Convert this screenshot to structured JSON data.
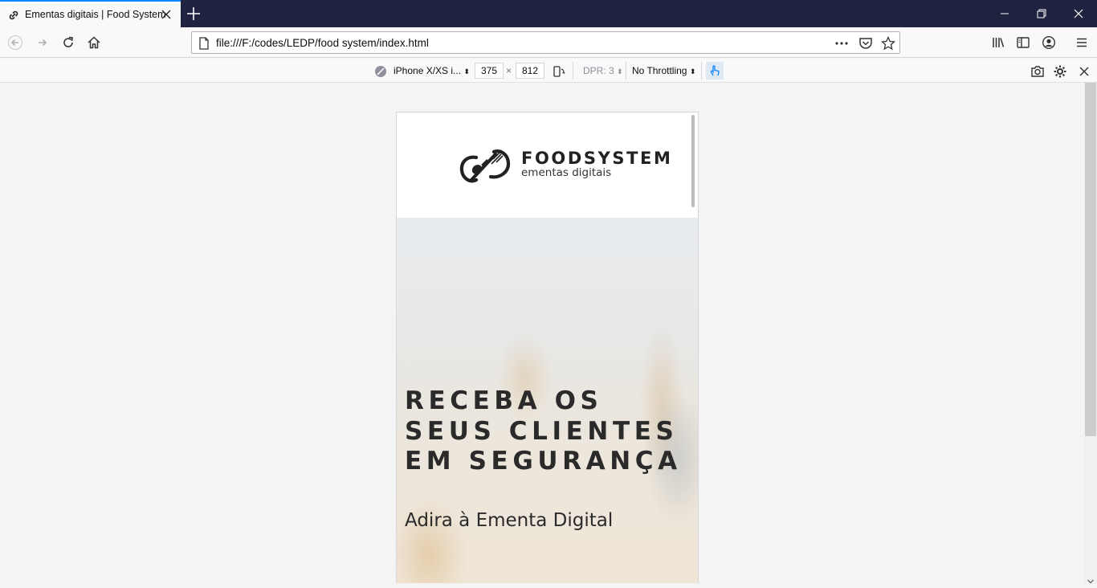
{
  "browser": {
    "tab_title": "Ementas digitais | Food System",
    "url": "file:///F:/codes/LEDP/food system/index.html"
  },
  "rdm": {
    "device": "iPhone X/XS i...",
    "width": "375",
    "times": "×",
    "height": "812",
    "dpr": "DPR: 3",
    "throttling": "No Throttling"
  },
  "site": {
    "logo_name": "FOODSYSTEM",
    "logo_tag": "ementas digitais",
    "hero_title": "RECEBA OS SEUS CLIENTES EM SEGURANÇA",
    "hero_subtitle": "Adira à Ementa Digital"
  },
  "colors": {
    "accent": "#0a84ff",
    "titlebar": "#202340",
    "hero_text": "#2a2a2a"
  }
}
